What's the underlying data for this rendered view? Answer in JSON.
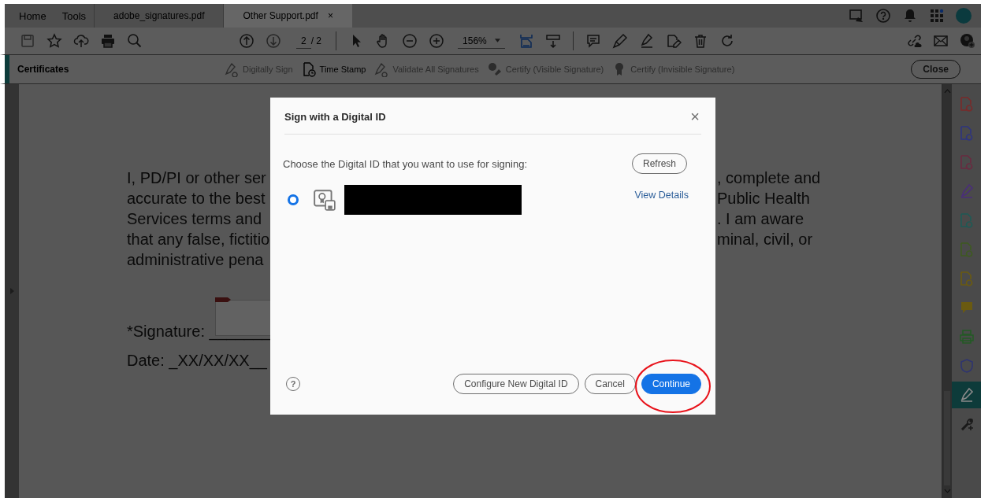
{
  "top_bar": {
    "nav": [
      "Home",
      "Tools"
    ],
    "tabs": [
      {
        "label": "adobe_signatures.pdf",
        "selected": false
      },
      {
        "label": "Other Support.pdf",
        "selected": true,
        "close": "×"
      }
    ]
  },
  "toolbar": {
    "page_number": "2",
    "page_total": "/ 2",
    "zoom": "156%"
  },
  "certificates_bar": {
    "title": "Certificates",
    "tools": [
      {
        "label": "Digitally Sign",
        "disabled": true,
        "kind": "sign"
      },
      {
        "label": "Time Stamp",
        "disabled": false,
        "kind": "stamp"
      },
      {
        "label": "Validate All Signatures",
        "disabled": true,
        "kind": "validate"
      },
      {
        "label": "Certify (Visible Signature)",
        "disabled": true,
        "kind": "certify"
      },
      {
        "label": "Certify (Invisible Signature)",
        "disabled": true,
        "kind": "ribbon"
      }
    ],
    "close": "Close"
  },
  "document": {
    "lines": [
      {
        "left": "I, PD/PI or other ser",
        "right": ", complete and"
      },
      {
        "left": "accurate to the best",
        "right": "Public Health"
      },
      {
        "left": "Services terms and",
        "right": ". I am aware"
      },
      {
        "left": "that any false, fictitio",
        "right": "minal, civil, or"
      },
      {
        "left": "administrative pena"
      }
    ],
    "signature": "*Signature: _______",
    "date": "Date: _XX/XX/XX__"
  },
  "right_panel": [
    {
      "kind": "create",
      "selected": false
    },
    {
      "kind": "export",
      "selected": false
    },
    {
      "kind": "organize",
      "selected": false
    },
    {
      "kind": "fill",
      "selected": false
    },
    {
      "kind": "send",
      "selected": false
    },
    {
      "kind": "compress",
      "selected": false
    },
    {
      "kind": "edit",
      "selected": false
    },
    {
      "kind": "comment",
      "selected": false
    },
    {
      "kind": "print",
      "selected": false
    },
    {
      "kind": "protect",
      "selected": false
    },
    {
      "kind": "certificate",
      "selected": true
    },
    {
      "kind": "more",
      "selected": false
    }
  ],
  "dialog": {
    "title": "Sign with a Digital ID",
    "close": "×",
    "prompt": "Choose the Digital ID that you want to use for signing:",
    "refresh": "Refresh",
    "ids": [
      {
        "selected": true,
        "redacted": true,
        "details": "View Details"
      }
    ],
    "help": "?",
    "buttons": [
      {
        "label": "Configure New Digital ID",
        "kind": "secondary"
      },
      {
        "label": "Cancel",
        "kind": "secondary"
      },
      {
        "label": "Continue",
        "kind": "primary"
      }
    ]
  }
}
